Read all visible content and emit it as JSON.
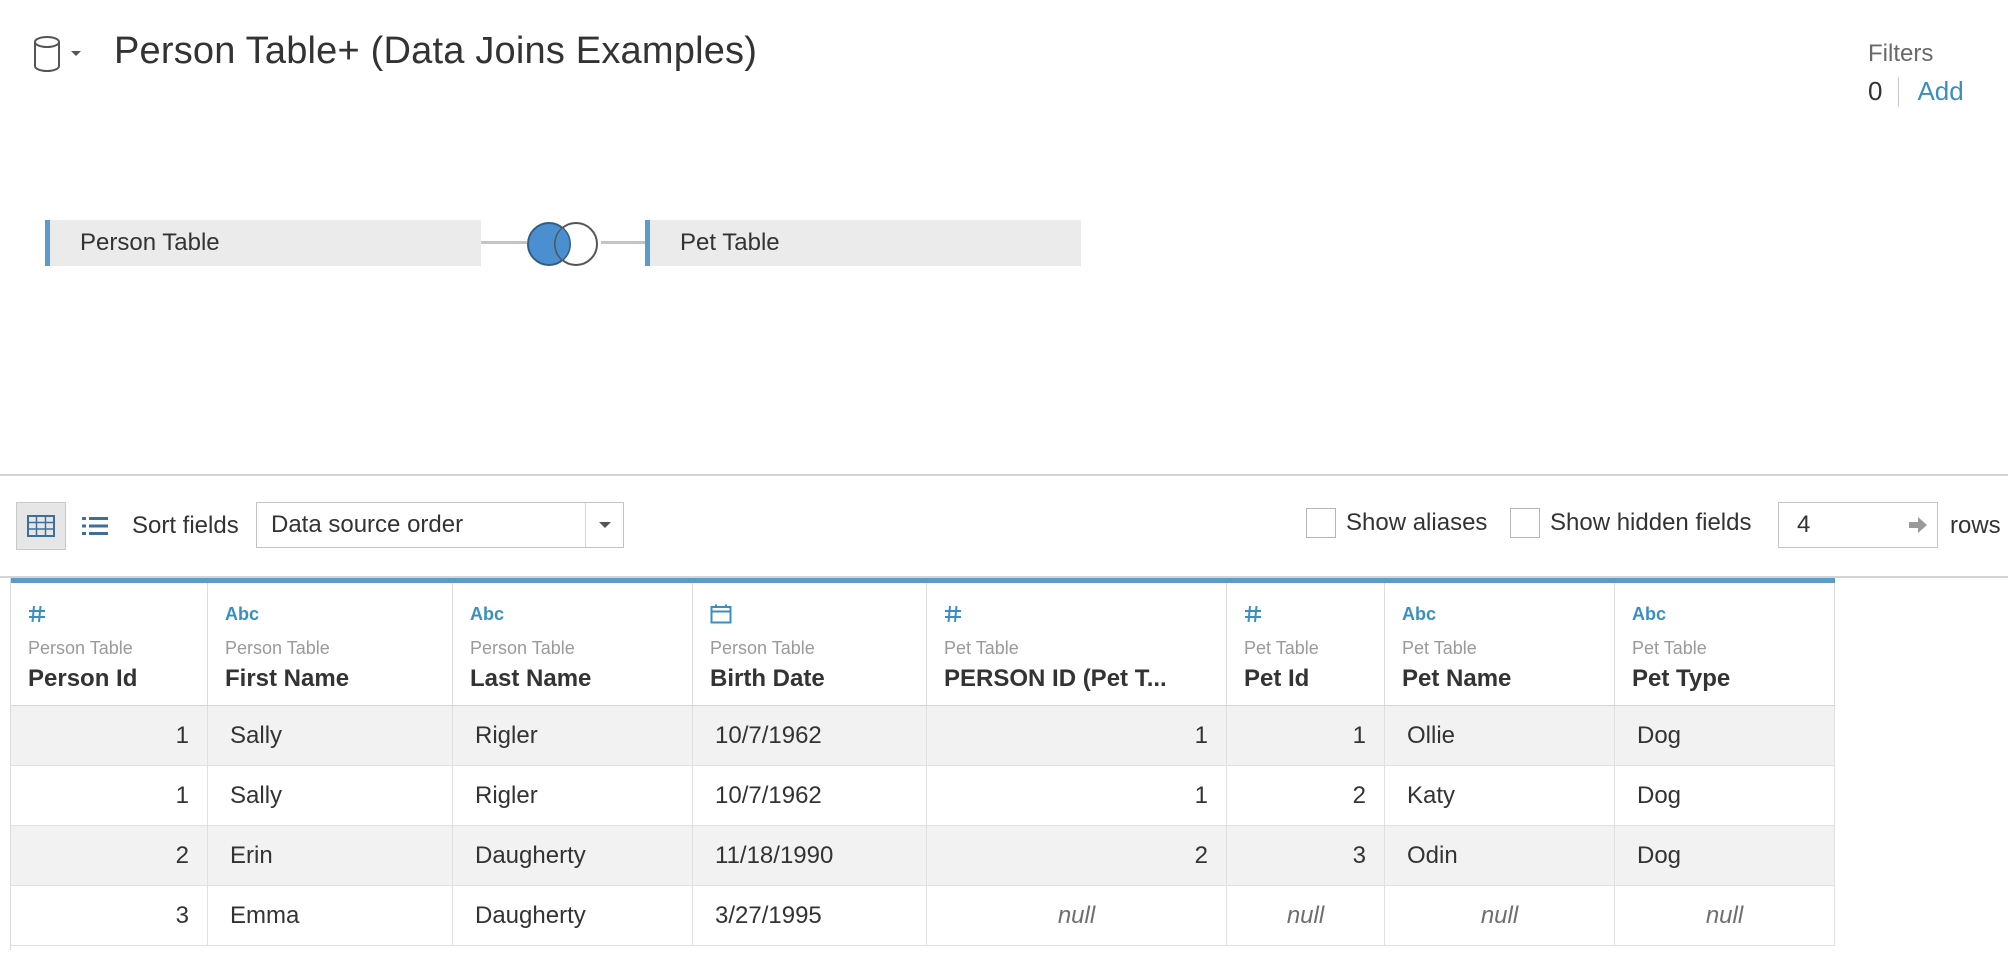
{
  "header": {
    "title": "Person Table+ (Data Joins Examples)",
    "datasource_icon": "database-icon"
  },
  "filters": {
    "label": "Filters",
    "count": "0",
    "add_label": "Add"
  },
  "join": {
    "left_table": "Person Table",
    "right_table": "Pet Table",
    "join_type": "left",
    "join_icon": "left-join-venn-icon",
    "accent_color": "#5b9bc9",
    "venn_fill": "#4a90d0"
  },
  "toolbar": {
    "sort_label": "Sort fields",
    "sort_value": "Data source order",
    "show_aliases": "Show aliases",
    "show_hidden": "Show hidden fields",
    "rows_value": "4",
    "rows_label": "rows"
  },
  "grid": {
    "columns": [
      {
        "type": "#",
        "type_icon": "number-icon",
        "source": "Person Table",
        "name": "Person Id"
      },
      {
        "type": "Abc",
        "type_icon": "string-icon",
        "source": "Person Table",
        "name": "First Name"
      },
      {
        "type": "Abc",
        "type_icon": "string-icon",
        "source": "Person Table",
        "name": "Last Name"
      },
      {
        "type": "date",
        "type_icon": "calendar-icon",
        "source": "Person Table",
        "name": "Birth Date"
      },
      {
        "type": "#",
        "type_icon": "number-icon",
        "source": "Pet Table",
        "name": "PERSON ID (Pet T..."
      },
      {
        "type": "#",
        "type_icon": "number-icon",
        "source": "Pet Table",
        "name": "Pet Id"
      },
      {
        "type": "Abc",
        "type_icon": "string-icon",
        "source": "Pet Table",
        "name": "Pet Name"
      },
      {
        "type": "Abc",
        "type_icon": "string-icon",
        "source": "Pet Table",
        "name": "Pet Type"
      }
    ],
    "rows": [
      [
        "1",
        "Sally",
        "Rigler",
        "10/7/1962",
        "1",
        "1",
        "Ollie",
        "Dog"
      ],
      [
        "1",
        "Sally",
        "Rigler",
        "10/7/1962",
        "1",
        "2",
        "Katy",
        "Dog"
      ],
      [
        "2",
        "Erin",
        "Daugherty",
        "11/18/1990",
        "2",
        "3",
        "Odin",
        "Dog"
      ],
      [
        "3",
        "Emma",
        "Daugherty",
        "3/27/1995",
        "null",
        "null",
        "null",
        "null"
      ]
    ]
  }
}
